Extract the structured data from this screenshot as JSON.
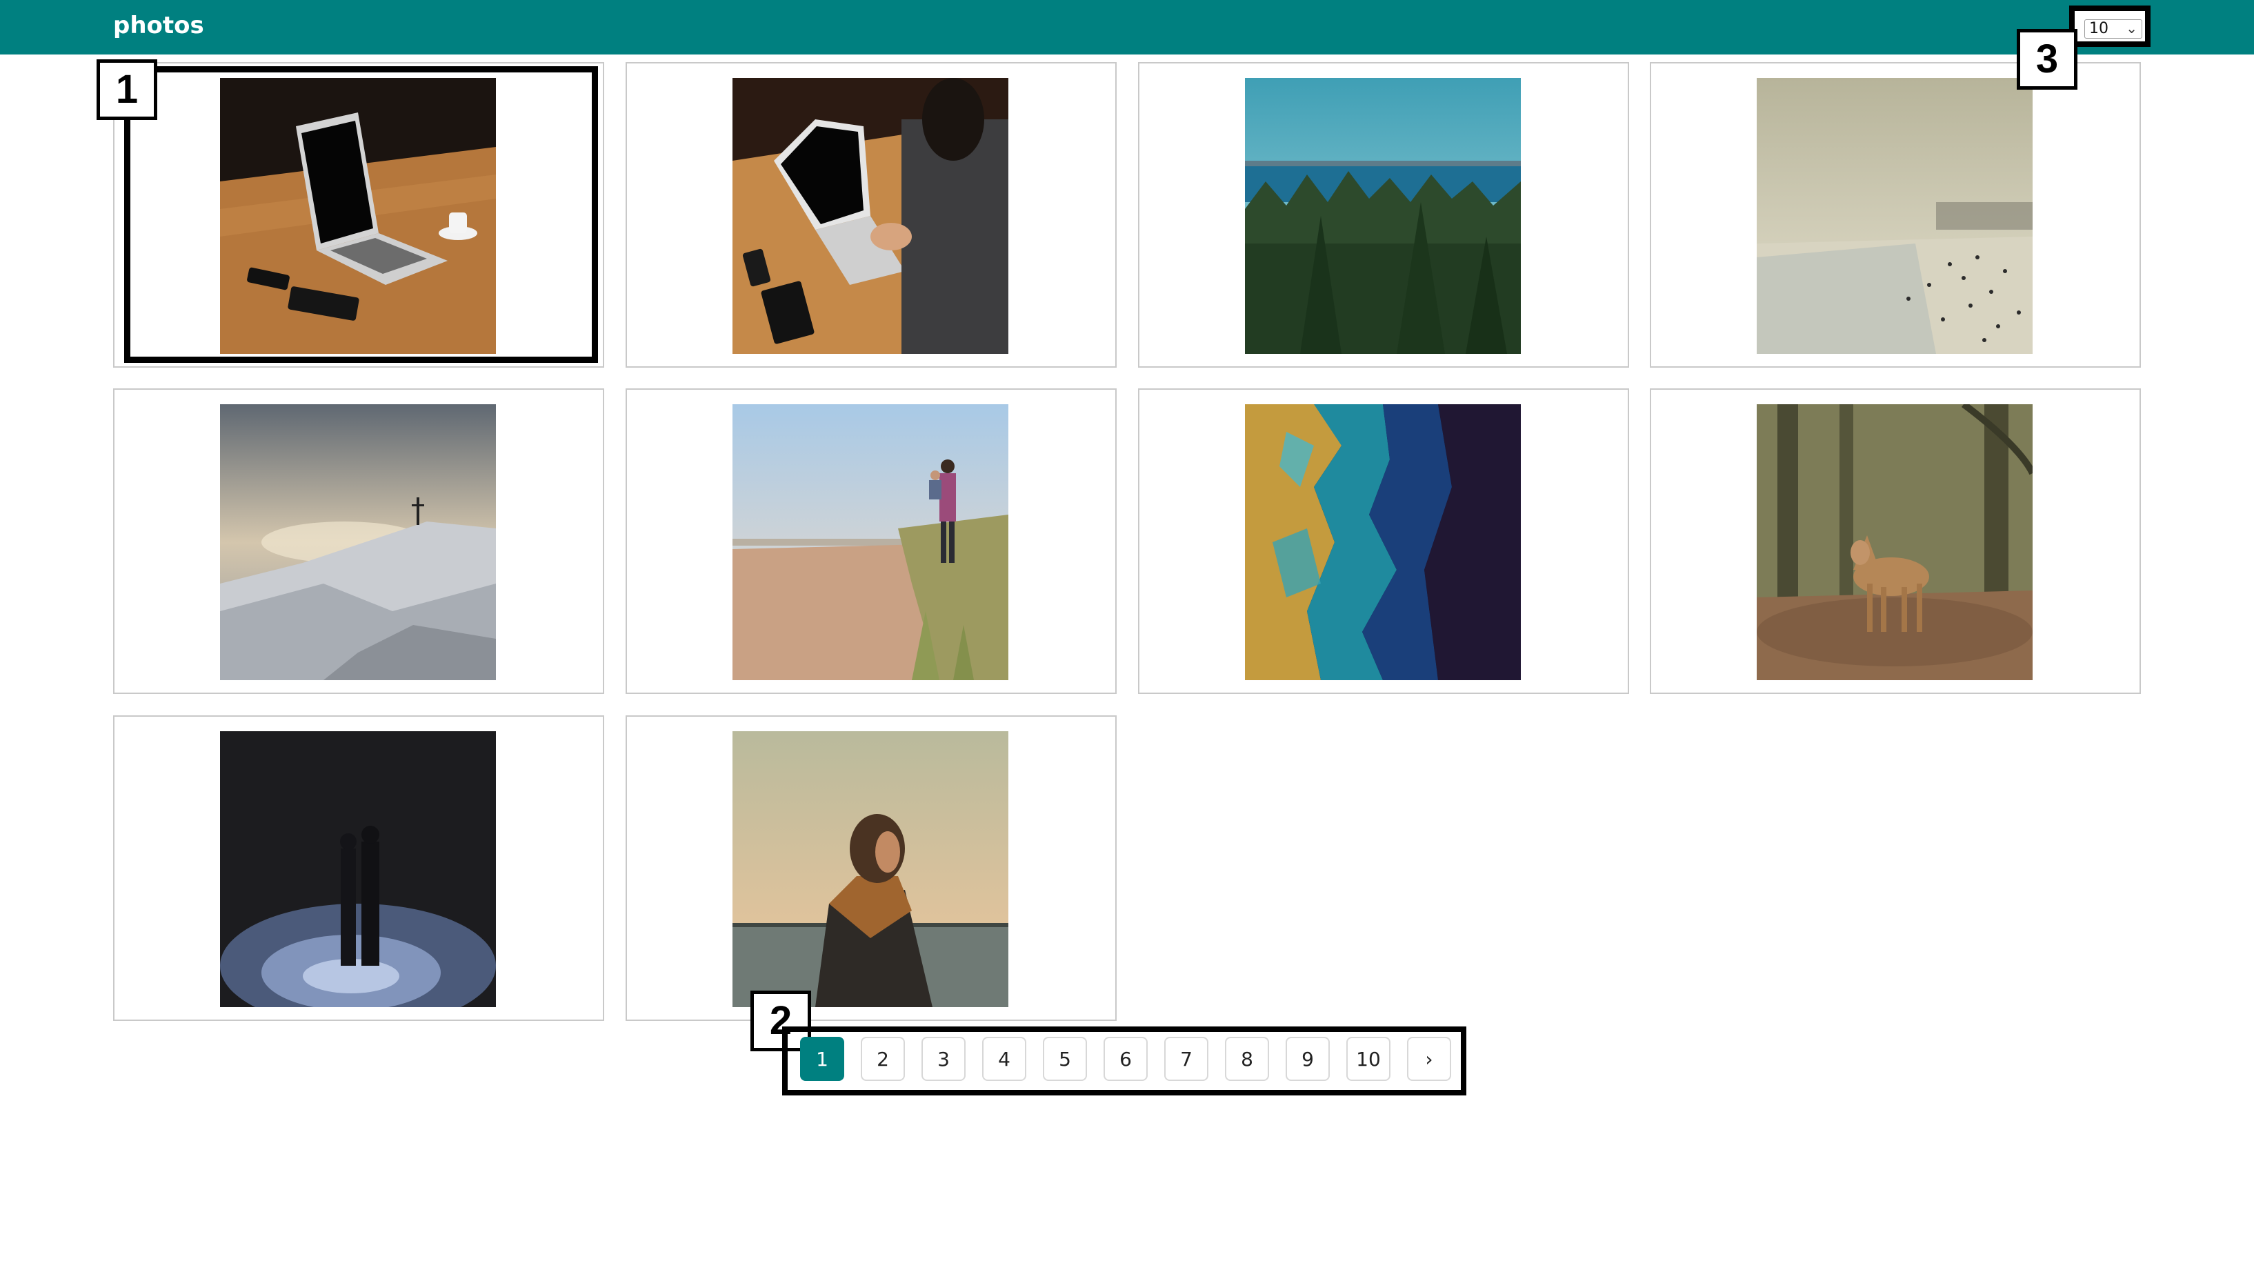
{
  "header": {
    "title": "photos",
    "per_page": {
      "value": "10",
      "icon": "chevron-down-icon"
    }
  },
  "callouts": [
    "1",
    "2",
    "3"
  ],
  "photos": [
    {
      "subject": "laptop-on-wooden-desk"
    },
    {
      "subject": "person-typing-on-laptop"
    },
    {
      "subject": "forest-and-sea"
    },
    {
      "subject": "hazy-beach-crowd"
    },
    {
      "subject": "snowy-summit-cross"
    },
    {
      "subject": "father-child-beach-path"
    },
    {
      "subject": "aerial-ocean-coast"
    },
    {
      "subject": "fawn-in-forest"
    },
    {
      "subject": "couple-night-snow"
    },
    {
      "subject": "man-scarf-sunset-sea"
    }
  ],
  "pagination": {
    "pages": [
      "1",
      "2",
      "3",
      "4",
      "5",
      "6",
      "7",
      "8",
      "9",
      "10"
    ],
    "current": "1",
    "next_icon": "chevron-right-icon",
    "accent": "#008080"
  },
  "colors": {
    "header": "#008080",
    "active_page": "#008080"
  }
}
